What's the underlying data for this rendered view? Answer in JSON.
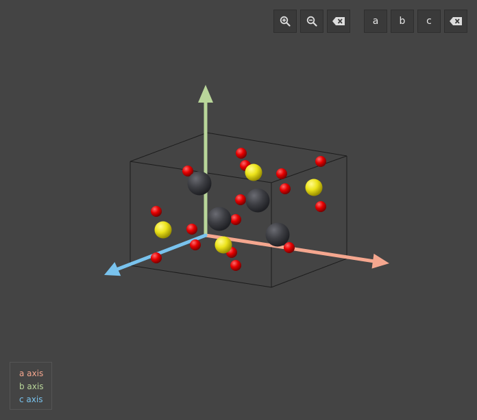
{
  "toolbar": {
    "zoom_in_icon": "zoom-in",
    "zoom_out_icon": "zoom-out",
    "reset_view_icon": "backspace",
    "axis_buttons": [
      "a",
      "b",
      "c"
    ],
    "reset_axis_icon": "backspace"
  },
  "legend": {
    "a": {
      "label": "a axis",
      "color": "#f5a78f"
    },
    "b": {
      "label": "b axis",
      "color": "#b9d69a"
    },
    "c": {
      "label": "c axis",
      "color": "#79c3ee"
    }
  },
  "atoms": {
    "large_dark_color": "#3c3d42",
    "yellow_color": "#ece31b",
    "red_color": "#e60000"
  }
}
